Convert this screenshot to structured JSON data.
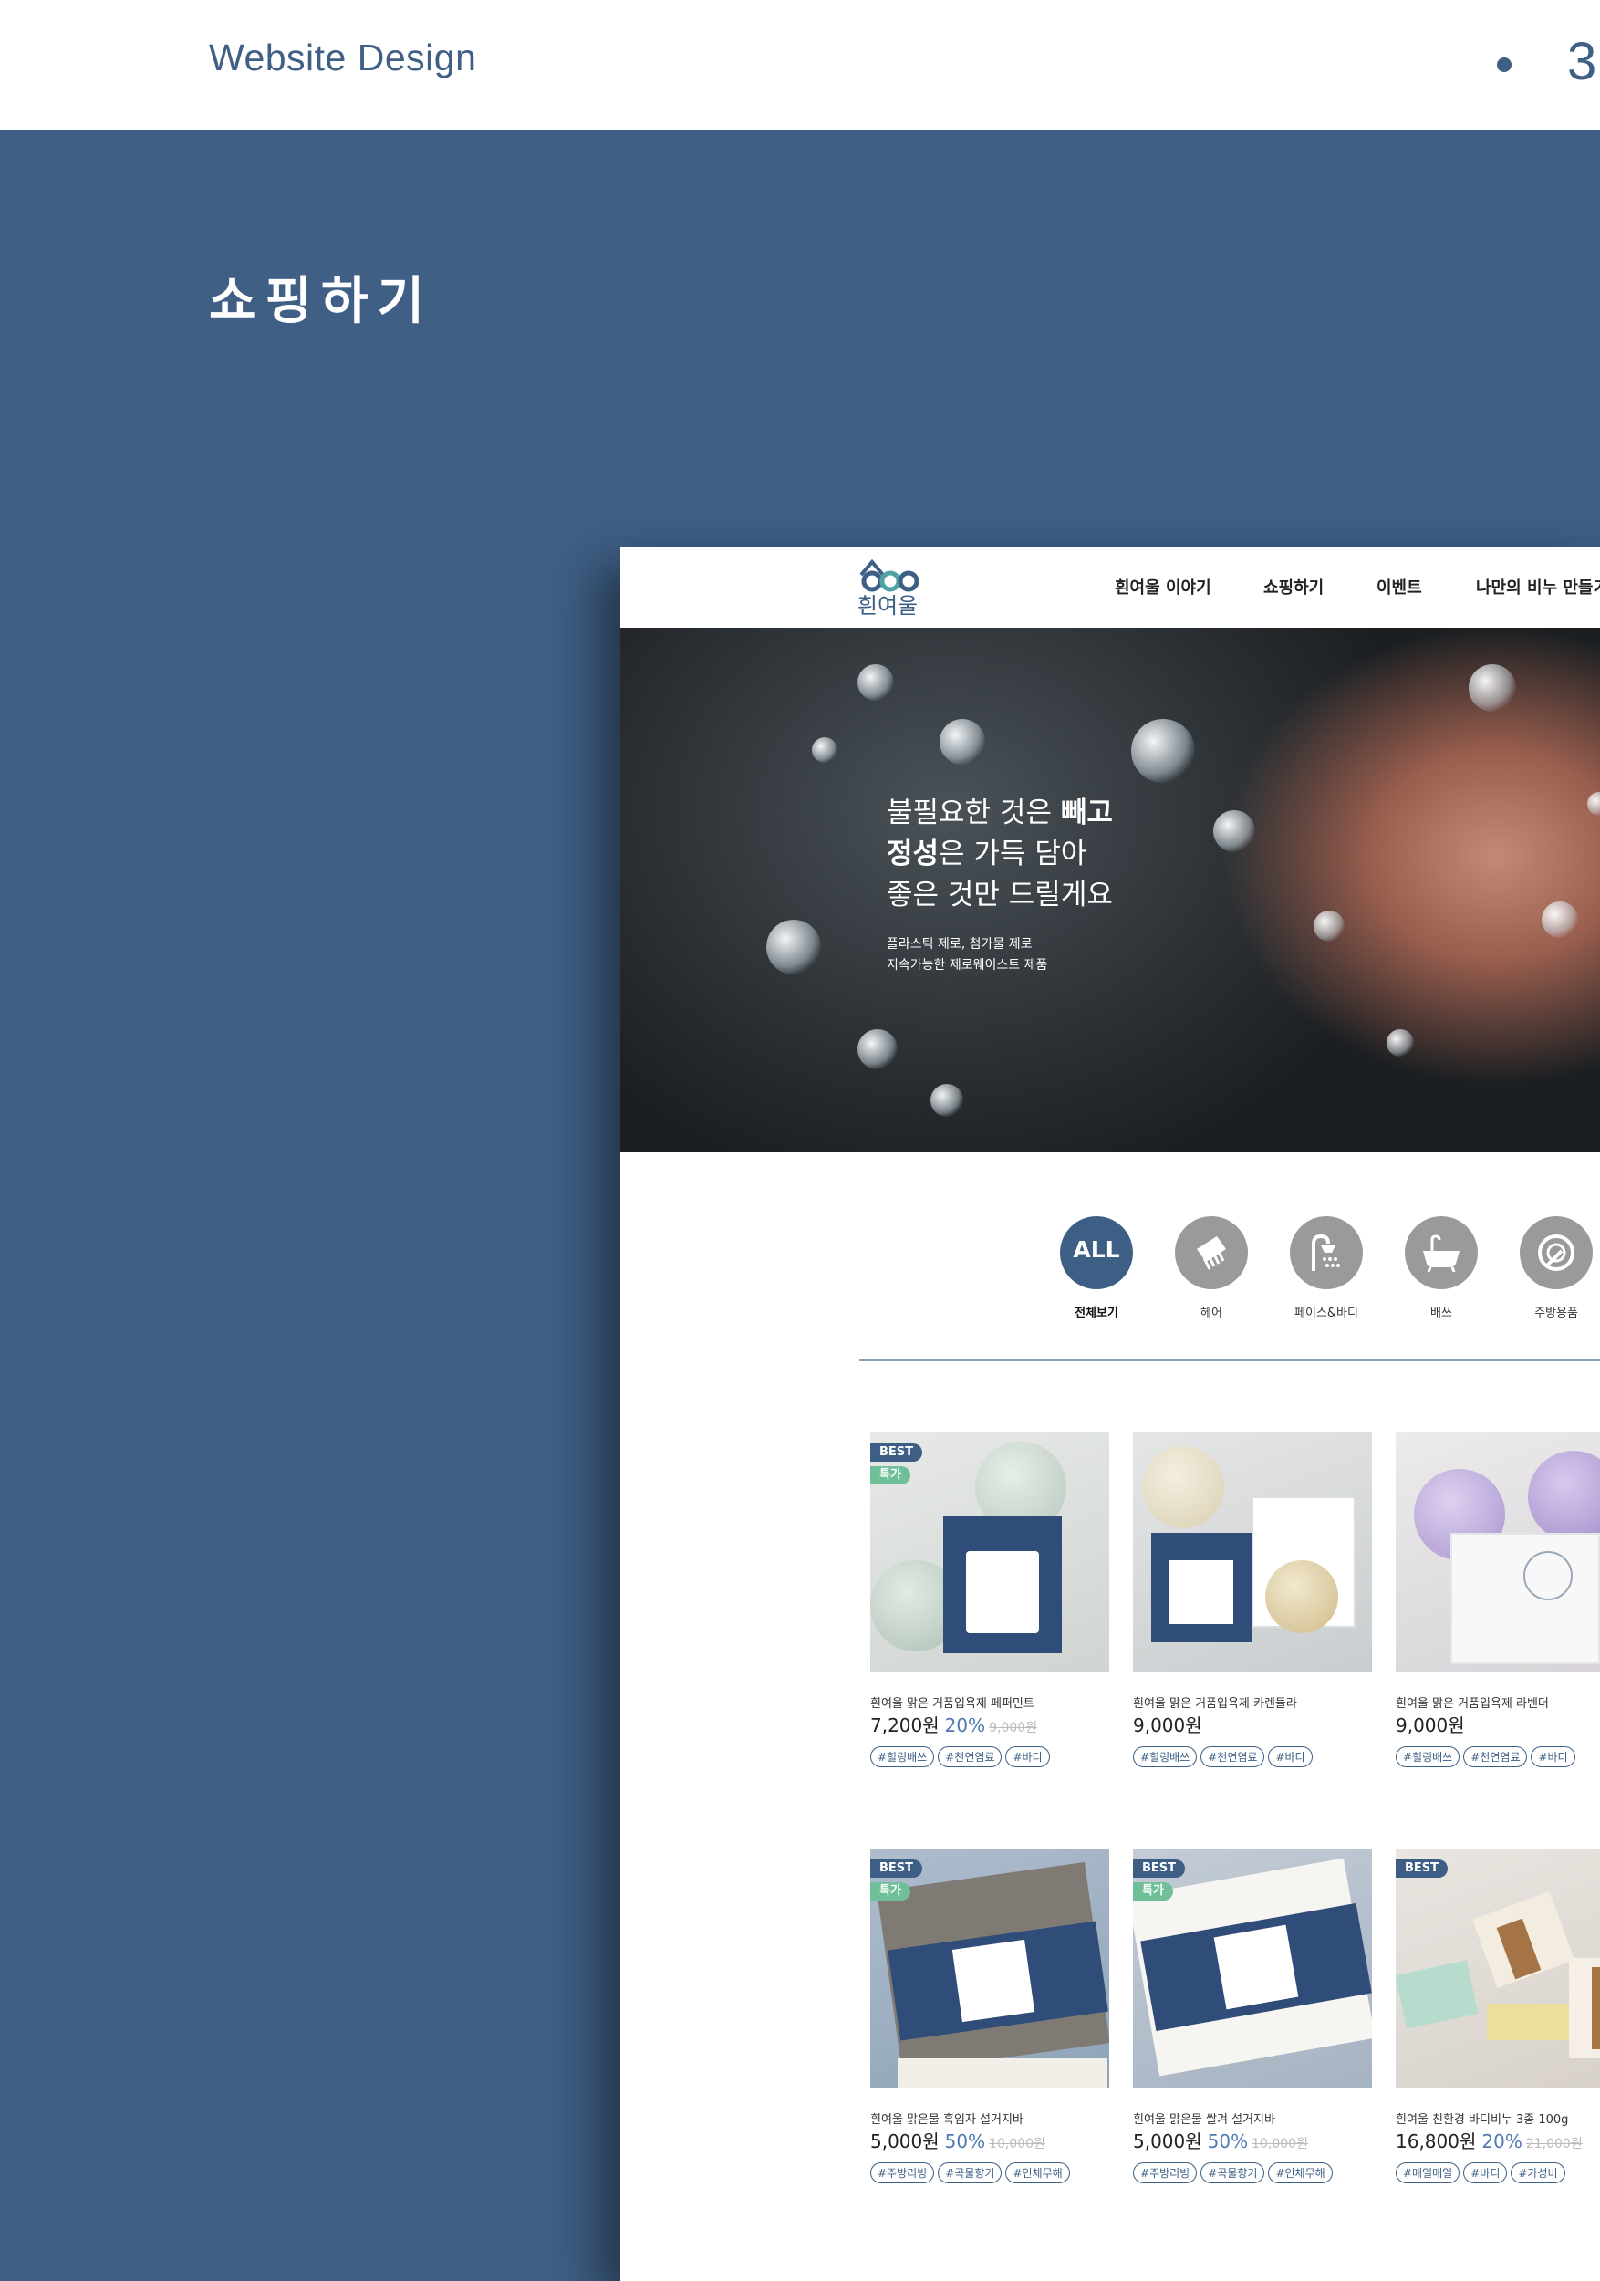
{
  "page": {
    "header_label": "Website Design",
    "page_number": "3",
    "section_title": "쇼핑하기"
  },
  "site": {
    "logo_text": "흰여울",
    "nav": [
      "흰여울 이야기",
      "쇼핑하기",
      "이벤트",
      "나만의 비누 만들기"
    ],
    "hero": {
      "line1_a": "불필요한 것은 ",
      "line1_b": "빼고",
      "line2_a": "정성",
      "line2_b": "은 가득 담아",
      "line3": "좋은 것만 드릴게요",
      "sub1": "플라스틱 제로, 첨가물 제로",
      "sub2": "지속가능한 제로웨이스트 제품"
    },
    "categories": [
      {
        "label": "전체보기",
        "icon": "ALL",
        "active": true
      },
      {
        "label": "헤어",
        "icon": "comb-icon"
      },
      {
        "label": "페이스&바디",
        "icon": "shower-icon"
      },
      {
        "label": "배쓰",
        "icon": "bathtub-icon"
      },
      {
        "label": "주방용품",
        "icon": "dish-sponge-icon"
      }
    ],
    "products": [
      {
        "name": "흰여울 맑은 거품입욕제 페퍼민트",
        "price": "7,200원",
        "discount": "20%",
        "original": "9,000원",
        "best": "BEST",
        "sale": "특가",
        "tags": [
          "#힐링배쓰",
          "#천연염료",
          "#바디"
        ]
      },
      {
        "name": "흰여울 맑은 거품입욕제 카렌듈라",
        "price": "9,000원",
        "tags": [
          "#힐링배쓰",
          "#천연염료",
          "#바디"
        ]
      },
      {
        "name": "흰여울 맑은 거품입욕제 라벤더",
        "price": "9,000원",
        "tags": [
          "#힐링배쓰",
          "#천연염료",
          "#바디"
        ]
      },
      {
        "name": "흰여울 맑은물 흑임자 설거지바",
        "price": "5,000원",
        "discount": "50%",
        "original": "10,000원",
        "best": "BEST",
        "sale": "특가",
        "tags": [
          "#주방리빙",
          "#곡물향기",
          "#인체무해"
        ]
      },
      {
        "name": "흰여울 맑은물 쌀겨 설거지바",
        "price": "5,000원",
        "discount": "50%",
        "original": "10,000원",
        "best": "BEST",
        "sale": "특가",
        "tags": [
          "#주방리빙",
          "#곡물향기",
          "#인체무해"
        ]
      },
      {
        "name": "흰여울 친환경 바디비누 3종 100g",
        "price": "16,800원",
        "discount": "20%",
        "original": "21,000원",
        "best": "BEST",
        "tags": [
          "#매일매일",
          "#바디",
          "#가성비"
        ]
      }
    ]
  }
}
